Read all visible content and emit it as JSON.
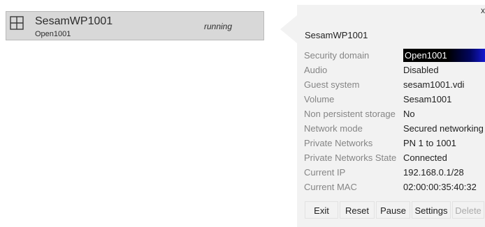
{
  "vm": {
    "name": "SesamWP1001",
    "domain": "Open1001",
    "status": "running",
    "icon": "grid-window-icon"
  },
  "popover": {
    "title": "SesamWP1001",
    "close": "x",
    "rows": [
      {
        "label": "Security domain",
        "value": "Open1001"
      },
      {
        "label": "Audio",
        "value": "Disabled"
      },
      {
        "label": "Guest system",
        "value": "sesam1001.vdi"
      },
      {
        "label": "Volume",
        "value": "Sesam1001"
      },
      {
        "label": "Non persistent storage",
        "value": "No"
      },
      {
        "label": "Network mode",
        "value": "Secured networking"
      },
      {
        "label": "Private Networks",
        "value": "PN 1 to 1001"
      },
      {
        "label": "Private Networks State",
        "value": "Connected"
      },
      {
        "label": "Current IP",
        "value": "192.168.0.1/28"
      },
      {
        "label": "Current MAC",
        "value": "02:00:00:35:40:32"
      }
    ],
    "buttons": {
      "exit": "Exit",
      "reset": "Reset",
      "pause": "Pause",
      "settings": "Settings",
      "delete": "Delete"
    }
  },
  "colors": {
    "card_bg": "#d8d8d8",
    "popover_bg": "#f2f2f2",
    "label": "#858585",
    "domain_gradient_end": "#1a1ef0"
  }
}
